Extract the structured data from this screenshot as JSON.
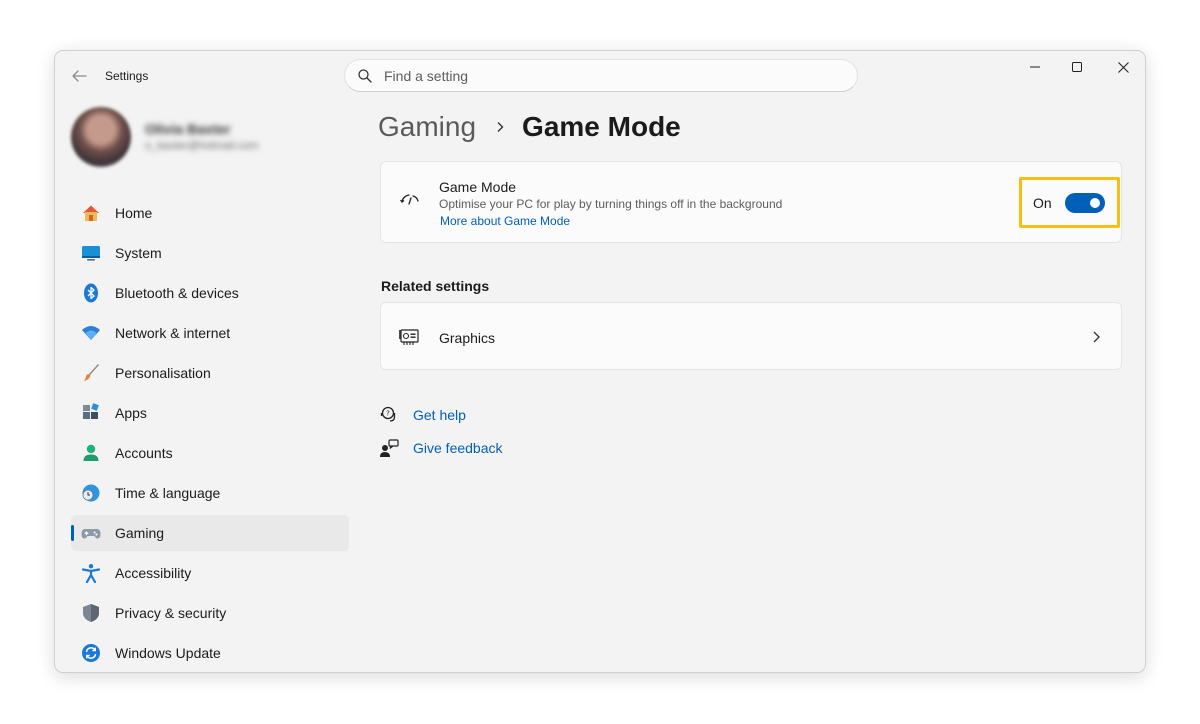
{
  "window": {
    "title": "Settings",
    "search_placeholder": "Find a setting"
  },
  "profile": {
    "name": "Olivia Baxter",
    "email": "o_baxter@hotmail.com"
  },
  "sidebar": {
    "items": [
      {
        "label": "Home",
        "icon": "home-icon"
      },
      {
        "label": "System",
        "icon": "system-icon"
      },
      {
        "label": "Bluetooth & devices",
        "icon": "bluetooth-icon"
      },
      {
        "label": "Network & internet",
        "icon": "wifi-icon"
      },
      {
        "label": "Personalisation",
        "icon": "brush-icon"
      },
      {
        "label": "Apps",
        "icon": "apps-icon"
      },
      {
        "label": "Accounts",
        "icon": "accounts-icon"
      },
      {
        "label": "Time & language",
        "icon": "time-language-icon"
      },
      {
        "label": "Gaming",
        "icon": "gamepad-icon",
        "active": true
      },
      {
        "label": "Accessibility",
        "icon": "accessibility-icon"
      },
      {
        "label": "Privacy & security",
        "icon": "shield-icon"
      },
      {
        "label": "Windows Update",
        "icon": "update-icon"
      }
    ],
    "active_indicator_color": "#005fb8"
  },
  "breadcrumb": {
    "parent": "Gaming",
    "current": "Game Mode"
  },
  "game_mode": {
    "title": "Game Mode",
    "description": "Optimise your PC for play by turning things off in the background",
    "link": "More about Game Mode",
    "toggle_state": "On",
    "toggle_on": true,
    "accent_color": "#005fb8",
    "highlight_color": "#f7be13"
  },
  "related": {
    "heading": "Related settings",
    "graphics_label": "Graphics"
  },
  "help": {
    "get_help": "Get help",
    "give_feedback": "Give feedback"
  }
}
